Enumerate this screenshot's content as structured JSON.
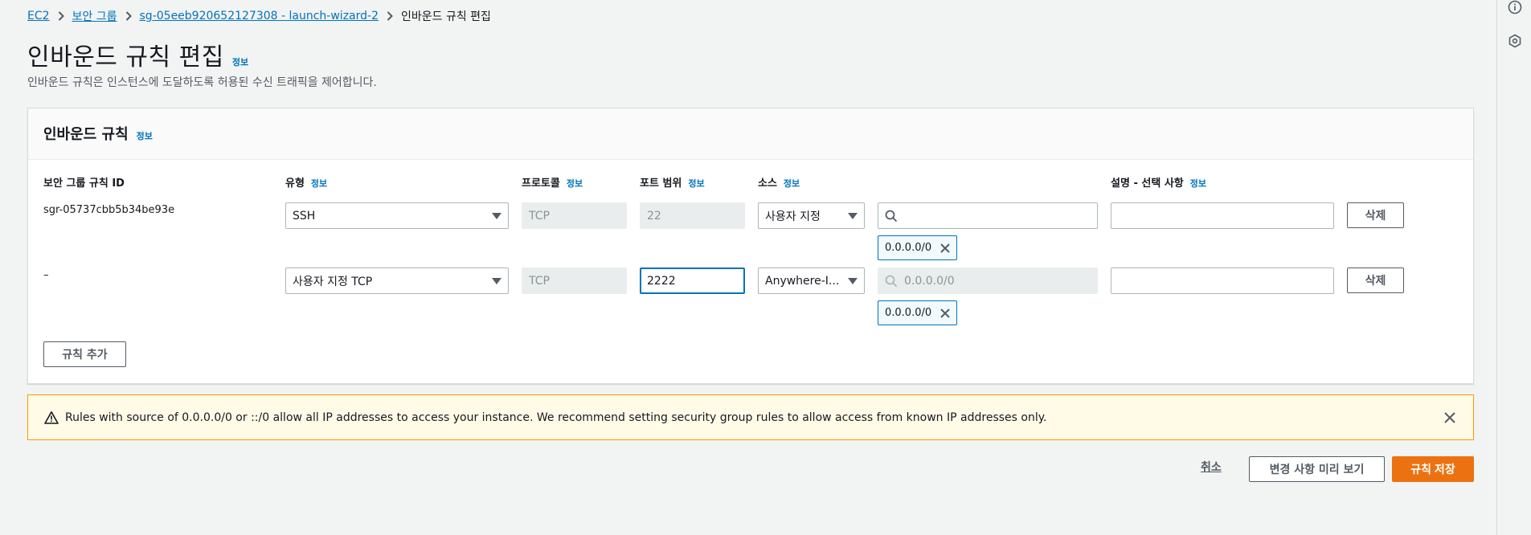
{
  "breadcrumb": {
    "items": [
      "EC2",
      "보안 그룹",
      "sg-05eeb920652127308 - launch-wizard-2"
    ],
    "current": "인바운드 규칙 편집"
  },
  "page": {
    "title": "인바운드 규칙 편집",
    "info": "정보",
    "description": "인바운드 규칙은 인스턴스에 도달하도록 허용된 수신 트래픽을 제어합니다."
  },
  "panel": {
    "title": "인바운드 규칙",
    "info": "정보",
    "columns": {
      "rule_id": "보안 그룹 규칙 ID",
      "type": "유형",
      "protocol": "프로토콜",
      "port_range": "포트 범위",
      "source": "소스",
      "description": "설명 - 선택 사항",
      "info": "정보"
    },
    "rows": [
      {
        "rule_id": "sgr-05737cbb5b34be93e",
        "type": "SSH",
        "protocol": "TCP",
        "port": "22",
        "source_type": "사용자 지정",
        "source_search": "",
        "source_placeholder": "",
        "cidr_token": "0.0.0.0/0",
        "description": "",
        "delete_label": "삭제"
      },
      {
        "rule_id": "–",
        "type": "사용자 지정 TCP",
        "protocol": "TCP",
        "port": "2222",
        "source_type": "Anywhere-I...",
        "source_search": "",
        "source_placeholder": "0.0.0.0/0",
        "cidr_token": "0.0.0.0/0",
        "description": "",
        "delete_label": "삭제"
      }
    ],
    "add_rule_label": "규칙 추가"
  },
  "alert": {
    "message": "Rules with source of 0.0.0.0/0 or ::/0 allow all IP addresses to access your instance. We recommend setting security group rules to allow access from known IP addresses only."
  },
  "footer": {
    "cancel": "취소",
    "preview": "변경 사항 미리 보기",
    "save": "규칙 저장"
  },
  "colors": {
    "link": "#0073bb",
    "primary": "#ec7211",
    "warning_border": "#ff9900",
    "warning_bg": "#fffbe6"
  }
}
